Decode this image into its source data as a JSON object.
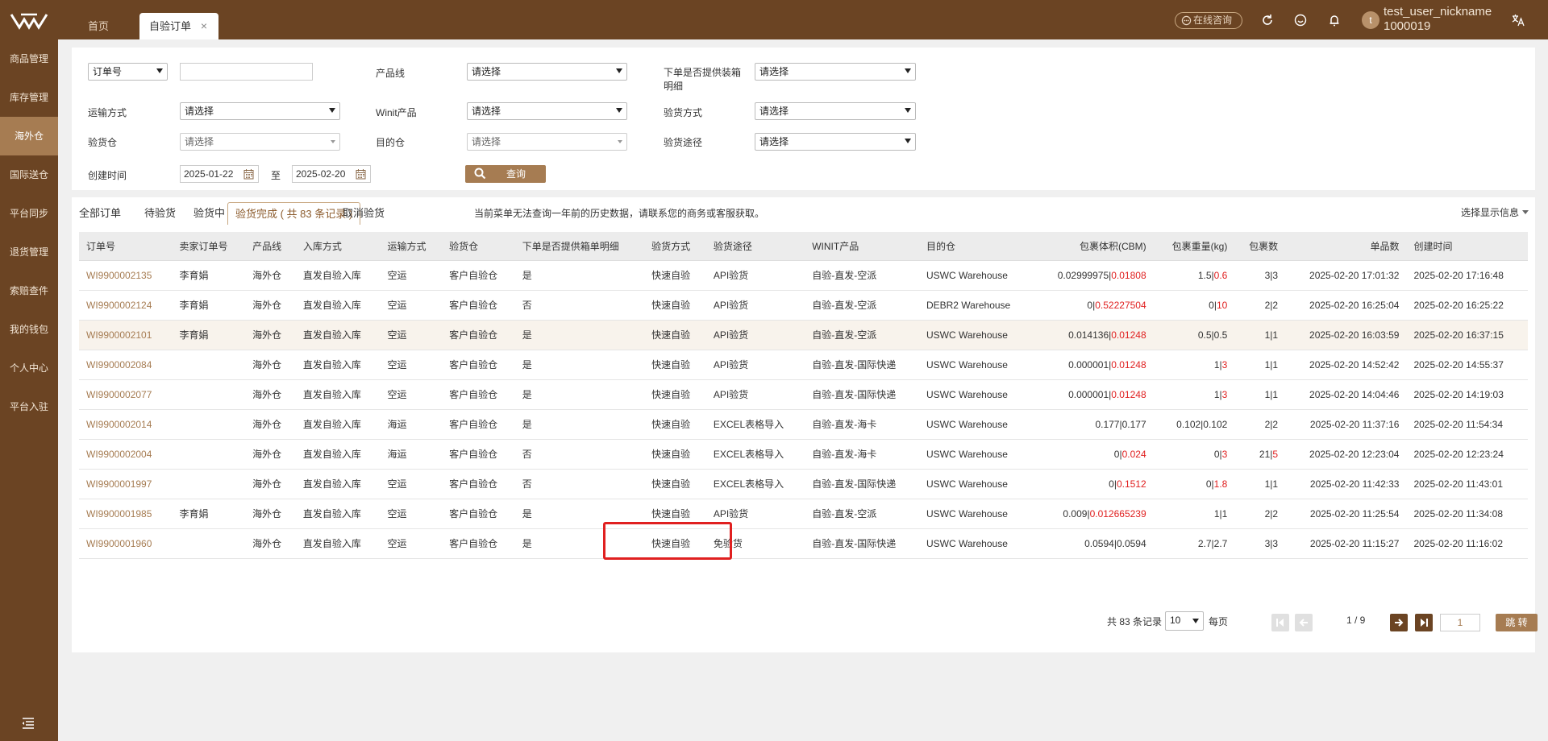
{
  "topbar": {
    "tabs": [
      {
        "label": "首页"
      },
      {
        "label": "自验订单"
      }
    ],
    "close_glyph": "×",
    "consult_label": "在线咨询",
    "avatar_letter": "t",
    "user_name": "test_user_nickname",
    "user_id": "1000019"
  },
  "sidebar": {
    "items": [
      {
        "label": "商品管理"
      },
      {
        "label": "库存管理"
      },
      {
        "label": "海外仓"
      },
      {
        "label": "国际送仓"
      },
      {
        "label": "平台同步"
      },
      {
        "label": "退货管理"
      },
      {
        "label": "索赔查件"
      },
      {
        "label": "我的钱包"
      },
      {
        "label": "个人中心"
      },
      {
        "label": "平台入驻"
      }
    ],
    "active_index": 2
  },
  "filters": {
    "order_type_select": "订单号",
    "product_line_label": "产品线",
    "product_line_value": "请选择",
    "packing_detail_label": "下单是否提供装箱明细",
    "packing_detail_value": "请选择",
    "transport_label": "运输方式",
    "transport_value": "请选择",
    "winit_product_label": "Winit产品",
    "winit_product_value": "请选择",
    "inspect_method_label": "验货方式",
    "inspect_method_value": "请选择",
    "inspect_warehouse_label": "验货仓",
    "inspect_warehouse_value": "请选择",
    "dest_warehouse_label": "目的仓",
    "dest_warehouse_value": "请选择",
    "inspect_route_label": "验货途径",
    "inspect_route_value": "请选择",
    "created_label": "创建时间",
    "date_from": "2025-01-22",
    "date_to_label": "至",
    "date_to": "2025-02-20",
    "search_label": "查询"
  },
  "status_tabs": [
    {
      "label": "全部订单"
    },
    {
      "label": "待验货"
    },
    {
      "label": "验货中"
    },
    {
      "label": "验货完成 ( 共 83 条记录 )"
    },
    {
      "label": "取消验货"
    }
  ],
  "notice": "当前菜单无法查询一年前的历史数据，请联系您的商务或客服获取。",
  "display_select_label": "选择显示信息",
  "table": {
    "headers": [
      "订单号",
      "卖家订单号",
      "产品线",
      "入库方式",
      "运输方式",
      "验货仓",
      "下单是否提供箱单明细",
      "验货方式",
      "验货途径",
      "WINIT产品",
      "目的仓",
      "包裹体积(CBM)",
      "包裹重量(kg)",
      "包裹数",
      "单品数",
      "创建时间"
    ],
    "rows": [
      {
        "order": "WI9900002135",
        "seller": "李育娟",
        "line": "海外仓",
        "inbound": "直发自验入库",
        "transport": "空运",
        "warehouse": "客户自验仓",
        "packing": "是",
        "method": "快速自验",
        "route": "API验货",
        "product": "自验-直发-空派",
        "dest": "USWC Warehouse",
        "vol_a": "0.02999975",
        "vol_b": "0.01808",
        "vol_red": true,
        "wt_a": "1.5",
        "wt_b": "0.6",
        "wt_red": true,
        "pk_a": "3",
        "pk_b": "3",
        "pk_red": false,
        "items": "2025-02-20 17:01:32",
        "created": "2025-02-20 17:16:48"
      },
      {
        "order": "WI9900002124",
        "seller": "李育娟",
        "line": "海外仓",
        "inbound": "直发自验入库",
        "transport": "空运",
        "warehouse": "客户自验仓",
        "packing": "否",
        "method": "快速自验",
        "route": "API验货",
        "product": "自验-直发-空派",
        "dest": "DEBR2 Warehouse",
        "vol_a": "0",
        "vol_b": "0.52227504",
        "vol_red": true,
        "wt_a": "0",
        "wt_b": "10",
        "wt_red": true,
        "pk_a": "2",
        "pk_b": "2",
        "pk_red": false,
        "items": "2025-02-20 16:25:04",
        "created": "2025-02-20 16:25:22"
      },
      {
        "order": "WI9900002101",
        "seller": "李育娟",
        "line": "海外仓",
        "inbound": "直发自验入库",
        "transport": "空运",
        "warehouse": "客户自验仓",
        "packing": "是",
        "method": "快速自验",
        "route": "API验货",
        "product": "自验-直发-空派",
        "dest": "USWC Warehouse",
        "vol_a": "0.014136",
        "vol_b": "0.01248",
        "vol_red": true,
        "wt_a": "0.5",
        "wt_b": "0.5",
        "wt_red": false,
        "pk_a": "1",
        "pk_b": "1",
        "pk_red": false,
        "items": "2025-02-20 16:03:59",
        "created": "2025-02-20 16:37:15"
      },
      {
        "order": "WI9900002084",
        "seller": "",
        "line": "海外仓",
        "inbound": "直发自验入库",
        "transport": "空运",
        "warehouse": "客户自验仓",
        "packing": "是",
        "method": "快速自验",
        "route": "API验货",
        "product": "自验-直发-国际快递",
        "dest": "USWC Warehouse",
        "vol_a": "0.000001",
        "vol_b": "0.01248",
        "vol_red": true,
        "wt_a": "1",
        "wt_b": "3",
        "wt_red": true,
        "pk_a": "1",
        "pk_b": "1",
        "pk_red": false,
        "items": "2025-02-20 14:52:42",
        "created": "2025-02-20 14:55:37"
      },
      {
        "order": "WI9900002077",
        "seller": "",
        "line": "海外仓",
        "inbound": "直发自验入库",
        "transport": "空运",
        "warehouse": "客户自验仓",
        "packing": "是",
        "method": "快速自验",
        "route": "API验货",
        "product": "自验-直发-国际快递",
        "dest": "USWC Warehouse",
        "vol_a": "0.000001",
        "vol_b": "0.01248",
        "vol_red": true,
        "wt_a": "1",
        "wt_b": "3",
        "wt_red": true,
        "pk_a": "1",
        "pk_b": "1",
        "pk_red": false,
        "items": "2025-02-20 14:04:46",
        "created": "2025-02-20 14:19:03"
      },
      {
        "order": "WI9900002014",
        "seller": "",
        "line": "海外仓",
        "inbound": "直发自验入库",
        "transport": "海运",
        "warehouse": "客户自验仓",
        "packing": "是",
        "method": "快速自验",
        "route": "EXCEL表格导入",
        "product": "自验-直发-海卡",
        "dest": "USWC Warehouse",
        "vol_a": "0.177",
        "vol_b": "0.177",
        "vol_red": false,
        "wt_a": "0.102",
        "wt_b": "0.102",
        "wt_red": false,
        "pk_a": "2",
        "pk_b": "2",
        "pk_red": false,
        "items": "2025-02-20 11:37:16",
        "created": "2025-02-20 11:54:34"
      },
      {
        "order": "WI9900002004",
        "seller": "",
        "line": "海外仓",
        "inbound": "直发自验入库",
        "transport": "海运",
        "warehouse": "客户自验仓",
        "packing": "否",
        "method": "快速自验",
        "route": "EXCEL表格导入",
        "product": "自验-直发-海卡",
        "dest": "USWC Warehouse",
        "vol_a": "0",
        "vol_b": "0.024",
        "vol_red": true,
        "wt_a": "0",
        "wt_b": "3",
        "wt_red": true,
        "pk_a": "21",
        "pk_b": "5",
        "pk_red": true,
        "items": "2025-02-20 12:23:04",
        "created": "2025-02-20 12:23:24"
      },
      {
        "order": "WI9900001997",
        "seller": "",
        "line": "海外仓",
        "inbound": "直发自验入库",
        "transport": "空运",
        "warehouse": "客户自验仓",
        "packing": "否",
        "method": "快速自验",
        "route": "EXCEL表格导入",
        "product": "自验-直发-国际快递",
        "dest": "USWC Warehouse",
        "vol_a": "0",
        "vol_b": "0.1512",
        "vol_red": true,
        "wt_a": "0",
        "wt_b": "1.8",
        "wt_red": true,
        "pk_a": "1",
        "pk_b": "1",
        "pk_red": false,
        "items": "2025-02-20 11:42:33",
        "created": "2025-02-20 11:43:01"
      },
      {
        "order": "WI9900001985",
        "seller": "李育娟",
        "line": "海外仓",
        "inbound": "直发自验入库",
        "transport": "空运",
        "warehouse": "客户自验仓",
        "packing": "是",
        "method": "快速自验",
        "route": "API验货",
        "product": "自验-直发-空派",
        "dest": "USWC Warehouse",
        "vol_a": "0.009",
        "vol_b": "0.012665239",
        "vol_red": true,
        "wt_a": "1",
        "wt_b": "1",
        "wt_red": false,
        "pk_a": "2",
        "pk_b": "2",
        "pk_red": false,
        "items": "2025-02-20 11:25:54",
        "created": "2025-02-20 11:34:08"
      },
      {
        "order": "WI9900001960",
        "seller": "",
        "line": "海外仓",
        "inbound": "直发自验入库",
        "transport": "空运",
        "warehouse": "客户自验仓",
        "packing": "是",
        "method": "快速自验",
        "route": "免验货",
        "product": "自验-直发-国际快递",
        "dest": "USWC Warehouse",
        "vol_a": "0.0594",
        "vol_b": "0.0594",
        "vol_red": false,
        "wt_a": "2.7",
        "wt_b": "2.7",
        "wt_red": false,
        "pk_a": "3",
        "pk_b": "3",
        "pk_red": false,
        "items": "2025-02-20 11:15:27",
        "created": "2025-02-20 11:16:02"
      }
    ],
    "highlighted_row": 2
  },
  "pagination": {
    "total_label": "共 83 条记录",
    "page_size": "10",
    "per_page_label": "每页",
    "page_indicator": "1 / 9",
    "jump_value": "1",
    "jump_label": "跳 转"
  },
  "colors": {
    "brand": "#6b4423",
    "accent": "#a67c52",
    "link": "#a67c52",
    "alert": "#e02020"
  },
  "icons": [
    "logo-icon",
    "chat-icon",
    "refresh-icon",
    "smiley-icon",
    "bell-icon",
    "translate-icon",
    "calendar-icon",
    "search-icon",
    "first-page-icon",
    "prev-page-icon",
    "next-page-icon",
    "last-page-icon",
    "collapse-menu-icon"
  ]
}
